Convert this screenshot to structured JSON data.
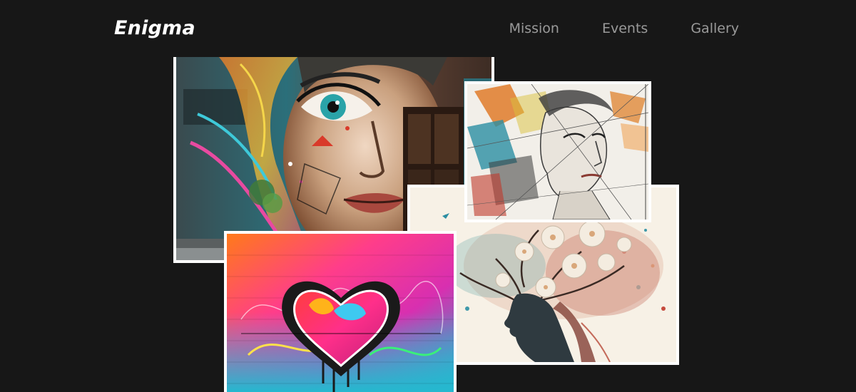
{
  "header": {
    "logo": "Enigma",
    "nav": [
      {
        "label": "Mission"
      },
      {
        "label": "Events"
      },
      {
        "label": "Gallery"
      }
    ]
  },
  "gallery": {
    "images": [
      {
        "subject": "street-art-woman-face-mural"
      },
      {
        "subject": "geometric-sketch-woman-portrait"
      },
      {
        "subject": "graffiti-heart-wall"
      },
      {
        "subject": "woman-profile-flower-tree"
      }
    ]
  },
  "colors": {
    "background": "#171717",
    "nav_text": "#9a9a9a",
    "logo_text": "#ffffff",
    "photo_border": "#ffffff"
  }
}
